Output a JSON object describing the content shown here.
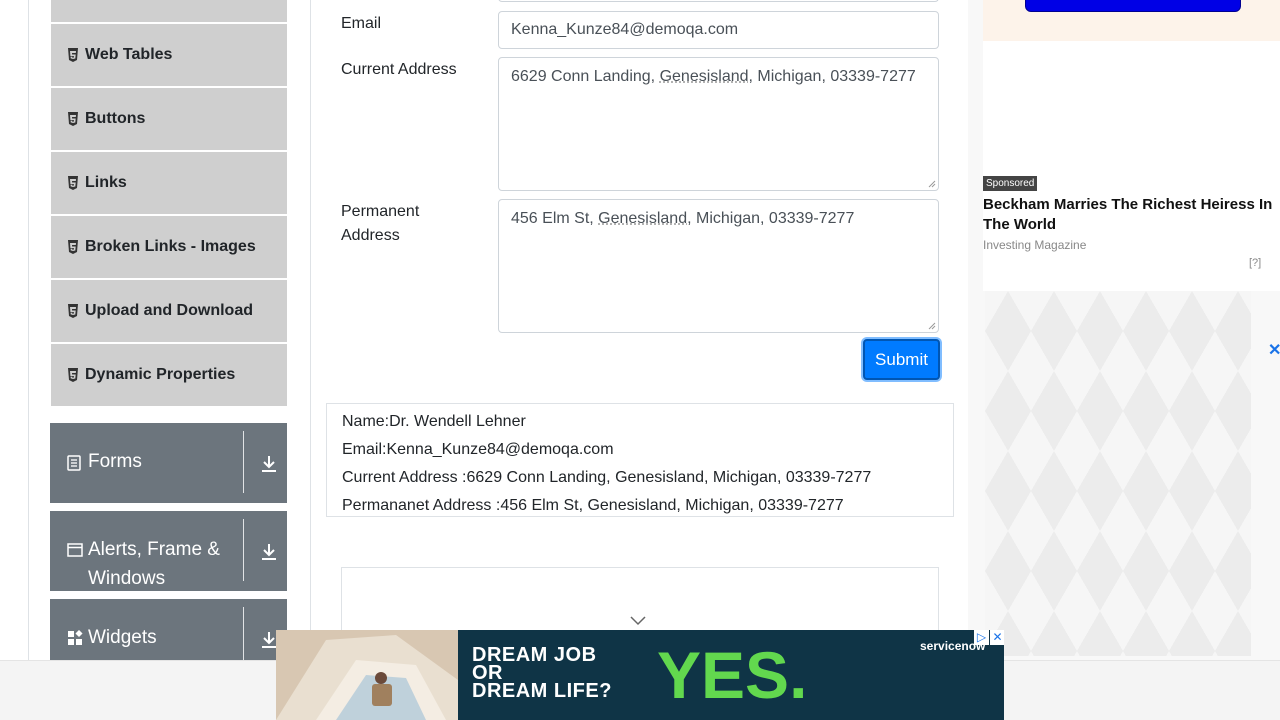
{
  "sidebar": {
    "elements": [
      {
        "label": "Web Tables"
      },
      {
        "label": "Buttons"
      },
      {
        "label": "Links"
      },
      {
        "label": "Broken Links - Images"
      },
      {
        "label": "Upload and Download"
      },
      {
        "label": "Dynamic Properties"
      }
    ],
    "groups": [
      {
        "label": "Forms",
        "icon": "document-icon"
      },
      {
        "label": "Alerts, Frame & Windows",
        "icon": "window-icon"
      },
      {
        "label": "Widgets",
        "icon": "widgets-icon"
      }
    ]
  },
  "form": {
    "email_label": "Email",
    "email_value": "Kenna_Kunze84@demoqa.com",
    "current_label": "Current Address",
    "current_value_pre": "6629 Conn Landing, ",
    "current_value_word": "Genesisland",
    "current_value_post": ", Michigan, 03339-7277",
    "permanent_label": "Permanent Address",
    "permanent_value_pre": "456 Elm St, ",
    "permanent_value_word": "Genesisland",
    "permanent_value_post": ", Michigan, 03339-7277",
    "submit_label": "Submit"
  },
  "output": {
    "name": "Name:Dr. Wendell Lehner",
    "email": "Email:Kenna_Kunze84@demoqa.com",
    "current": "Current Address :6629 Conn Landing, Genesisland, Michigan, 03339-7277",
    "permanent": "Permananet Address :456 Elm St, Genesisland, Michigan, 03339-7277"
  },
  "ads": {
    "sponsored_tag": "Sponsored",
    "headline": "Beckham Marries The Richest Heiress In The World",
    "source": "Investing Magazine",
    "info": "[?]",
    "close_glyph": "✕",
    "banner_line1": "DREAM JOB",
    "banner_line2": "OR",
    "banner_line3": "DREAM LIFE?",
    "banner_yes": "YES.",
    "banner_brand": "servicenow"
  },
  "colors": {
    "primary": "#007bff",
    "group_bg": "#6c757d",
    "item_bg": "#cfcfcf",
    "banner_bg": "#0f3446",
    "banner_accent": "#62d84e"
  }
}
